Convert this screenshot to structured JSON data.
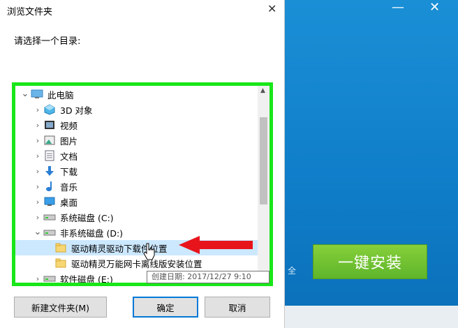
{
  "dialog": {
    "title": "浏览文件夹",
    "prompt": "请选择一个目录:",
    "close": "✕",
    "buttons": {
      "new_folder": "新建文件夹(M)",
      "ok": "确定",
      "cancel": "取消"
    },
    "tooltip": "创建日期: 2017/12/27 9:10"
  },
  "tree": {
    "items": [
      {
        "label": "此电脑",
        "level": 0,
        "expanded": true,
        "icon": "computer-icon"
      },
      {
        "label": "3D 对象",
        "level": 1,
        "icon": "3d-objects-icon"
      },
      {
        "label": "视频",
        "level": 1,
        "icon": "video-icon"
      },
      {
        "label": "图片",
        "level": 1,
        "icon": "pictures-icon"
      },
      {
        "label": "文档",
        "level": 1,
        "icon": "documents-icon"
      },
      {
        "label": "下载",
        "level": 1,
        "icon": "download-icon"
      },
      {
        "label": "音乐",
        "level": 1,
        "icon": "music-icon"
      },
      {
        "label": "桌面",
        "level": 1,
        "icon": "desktop-icon"
      },
      {
        "label": "系统磁盘 (C:)",
        "level": 1,
        "icon": "drive-icon"
      },
      {
        "label": "非系统磁盘 (D:)",
        "level": 1,
        "expanded": true,
        "icon": "drive-icon"
      },
      {
        "label": "驱动精灵驱动下载件位置",
        "level": 2,
        "selected": true,
        "icon": "folder-icon"
      },
      {
        "label": "驱动精灵万能网卡离线版安装位置",
        "level": 2,
        "icon": "folder-icon"
      },
      {
        "label": "软件磁盘 (E:)",
        "level": 1,
        "icon": "drive-icon"
      }
    ]
  },
  "background_app": {
    "install_button": "一键安装",
    "safe_text": "全",
    "minimize": "—",
    "close": "✕"
  },
  "colors": {
    "highlight": "#19e619",
    "accent": "#0078d7",
    "arrow": "#e8141c"
  }
}
